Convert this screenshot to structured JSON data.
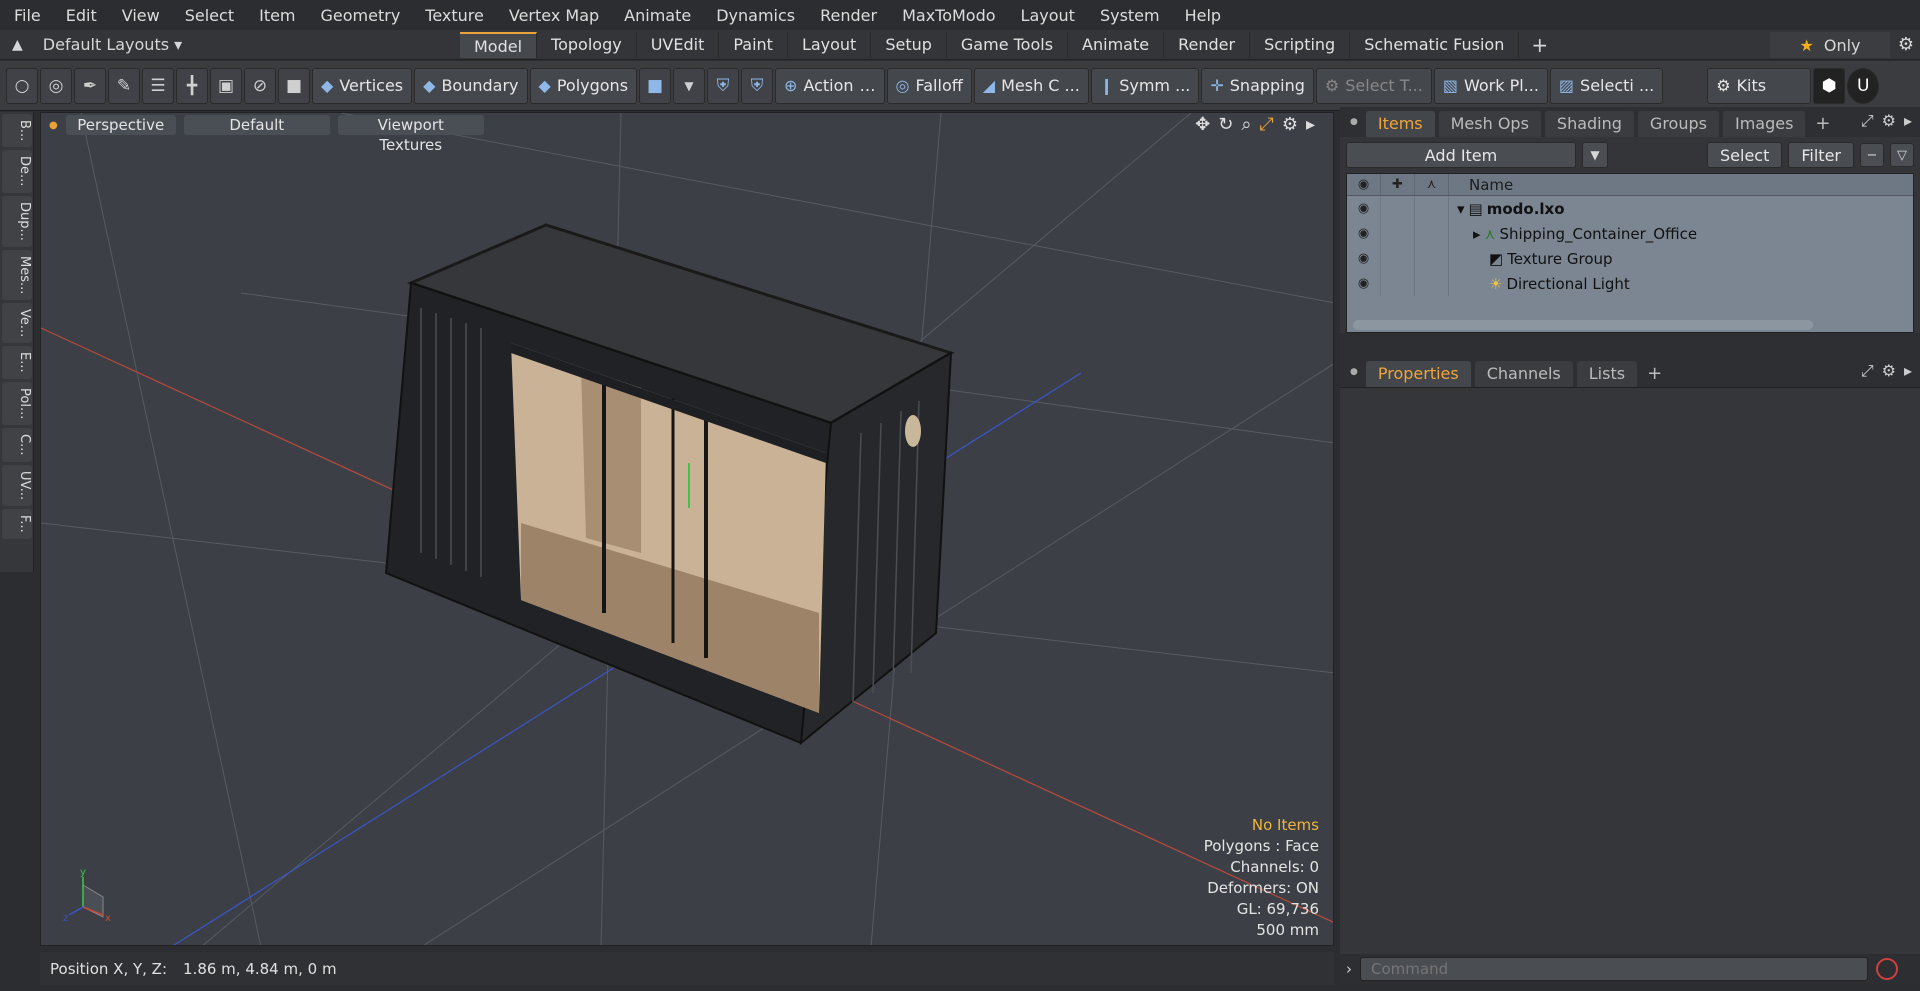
{
  "menu": [
    "File",
    "Edit",
    "View",
    "Select",
    "Item",
    "Geometry",
    "Texture",
    "Vertex Map",
    "Animate",
    "Dynamics",
    "Render",
    "MaxToModo",
    "Layout",
    "System",
    "Help"
  ],
  "layout_selector": "Default Layouts ▾",
  "layout_tabs": [
    "Model",
    "Topology",
    "UVEdit",
    "Paint",
    "Layout",
    "Setup",
    "Game Tools",
    "Animate",
    "Render",
    "Scripting",
    "Schematic Fusion"
  ],
  "active_layout_tab": "Model",
  "only_label": "Only",
  "toolbar": {
    "vertices": "Vertices",
    "boundary": "Boundary",
    "polygons": "Polygons",
    "action": "Action",
    "falloff": "Falloff",
    "mesh": "Mesh C ...",
    "symm": "Symm ...",
    "snapping": "Snapping",
    "select_t": "Select T...",
    "work_pl": "Work Pl...",
    "selecti": "Selecti ...",
    "kits": "Kits"
  },
  "sidebar_tabs": [
    "B...",
    "De...",
    "Dup...",
    "Mes...",
    "Ve...",
    "E...",
    "Pol...",
    "C...",
    "UV...",
    "F..."
  ],
  "viewport": {
    "view": "Perspective",
    "shading": "Default",
    "textures": "Viewport Textures",
    "info": {
      "selection": "No Items",
      "polygons": "Polygons : Face",
      "channels": "Channels: 0",
      "deformers": "Deformers: ON",
      "gl": "GL: 69,736",
      "scale": "500 mm"
    }
  },
  "status": {
    "label": "Position X, Y, Z:",
    "value": "1.86 m, 4.84 m, 0 m"
  },
  "items_panel": {
    "tabs": [
      "Items",
      "Mesh Ops",
      "Shading",
      "Groups",
      "Images"
    ],
    "add_item": "Add Item",
    "select": "Select",
    "filter": "Filter",
    "column_name": "Name",
    "rows": [
      {
        "label": "modo.lxo"
      },
      {
        "label": "Shipping_Container_Office"
      },
      {
        "label": "Texture Group"
      },
      {
        "label": "Directional Light"
      }
    ]
  },
  "props_panel": {
    "tabs": [
      "Properties",
      "Channels",
      "Lists"
    ]
  },
  "command": {
    "placeholder": "Command"
  },
  "colors": {
    "accent": "#e8a23a",
    "x_axis": "#c8483c",
    "z_axis": "#3a55c8",
    "y_axis": "#3ec44a"
  }
}
